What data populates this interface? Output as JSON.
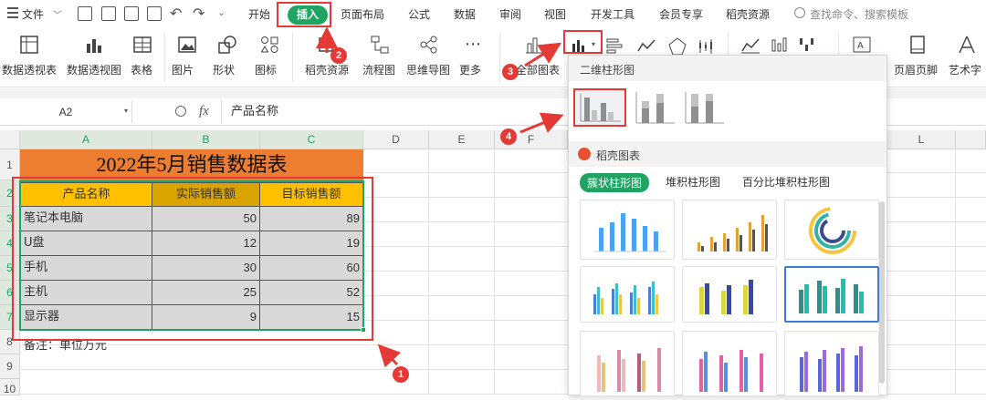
{
  "menu": {
    "file": "文件",
    "tabs": [
      "开始",
      "插入",
      "页面布局",
      "公式",
      "数据",
      "审阅",
      "视图",
      "开发工具",
      "会员专享",
      "稻壳资源"
    ],
    "search": "查找命令、搜索模板"
  },
  "ribbon": {
    "buttons": [
      "数据透视表",
      "数据透视图",
      "表格",
      "图片",
      "形状",
      "图标",
      "稻壳资源",
      "流程图",
      "思维导图",
      "更多",
      "全部图表",
      "页眉页脚",
      "艺术字"
    ]
  },
  "formula": {
    "name_box": "A2",
    "fx": "fx",
    "content": "产品名称"
  },
  "columns": [
    "A",
    "B",
    "C",
    "D",
    "E",
    "F",
    "L"
  ],
  "rows": [
    "1",
    "2",
    "3",
    "4",
    "5",
    "6",
    "7",
    "8",
    "9",
    "10"
  ],
  "sheet": {
    "title": "2022年5月销售数据表",
    "headers": [
      "产品名称",
      "实际销售额",
      "目标销售额"
    ],
    "data": [
      {
        "name": "笔记本电脑",
        "actual": "50",
        "target": "89"
      },
      {
        "name": "U盘",
        "actual": "12",
        "target": "19"
      },
      {
        "name": "手机",
        "actual": "30",
        "target": "60"
      },
      {
        "name": "主机",
        "actual": "25",
        "target": "52"
      },
      {
        "name": "显示器",
        "actual": "9",
        "target": "15"
      }
    ],
    "note": "备注：单位万元"
  },
  "panel": {
    "section1": "二维柱形图",
    "section2": "稻壳图表",
    "subtabs": [
      "簇状柱形图",
      "堆积柱形图",
      "百分比堆积柱形图"
    ]
  },
  "badges": [
    "1",
    "2",
    "3",
    "4"
  ],
  "colors": {
    "accent": "#1fa463",
    "title_bg": "#ed7d31",
    "header_bg": "#ffc000",
    "header_bg2": "#d9a300",
    "data_bg": "#d9d9d9",
    "annotation": "#e53935"
  }
}
